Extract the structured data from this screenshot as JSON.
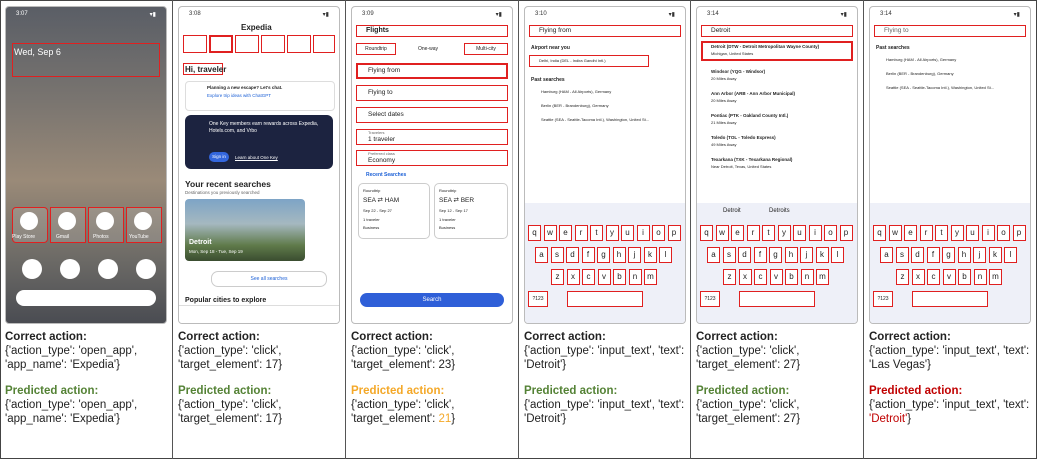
{
  "panels": [
    {
      "time": "3:07",
      "correct": "{'action_type': 'open_app', 'app_name': 'Expedia'}",
      "predicted": "{'action_type': 'open_app', 'app_name': 'Expedia'}",
      "status": "correct"
    },
    {
      "time": "3:08",
      "correct": "{'action_type': 'click', 'target_element': 17}",
      "predicted": "{'action_type': 'click', 'target_element': 17}",
      "status": "correct"
    },
    {
      "time": "3:09",
      "correct": "{'action_type': 'click', 'target_element': 23}",
      "predicted_prefix": "{'action_type': 'click', 'target_element': ",
      "predicted_value": "21",
      "predicted_suffix": "}",
      "status": "partial"
    },
    {
      "time": "3:10",
      "correct": "{'action_type': 'input_text', 'text': 'Detroit'}",
      "predicted": "{'action_type': 'input_text', 'text': 'Detroit'}",
      "status": "correct"
    },
    {
      "time": "3:14",
      "correct": "{'action_type': 'click', 'target_element': 27}",
      "predicted": "{'action_type': 'click', 'target_element': 27}",
      "status": "correct"
    },
    {
      "time": "3:14",
      "correct": "{'action_type': 'input_text', 'text': 'Las Vegas'}",
      "predicted_prefix": "{'action_type': 'input_text', 'text': ",
      "predicted_value": "'Detroit'",
      "predicted_suffix": "}",
      "status": "wrong"
    }
  ],
  "labels": {
    "correct_action": "Correct action:",
    "predicted_action": "Predicted action:"
  },
  "screen1": {
    "date": "Wed, Sep 6",
    "apps": [
      "Play Store",
      "Gmail",
      "Photos",
      "YouTube"
    ]
  },
  "screen2": {
    "brand": "Expedia",
    "greeting": "Hi, traveler",
    "promo_title": "Planning a new escape? Let's chat.",
    "promo_link": "Explore trip ideas with ChatGPT",
    "onekey": "One Key members earn rewards across Expedia, Hotels.com, and Vrbo",
    "signin": "Sign in",
    "learn": "Learn about One Key",
    "recent": "Your recent searches",
    "recent_sub": "Destinations you previously searched",
    "card_city": "Detroit",
    "card_dates": "Mon, Sep 18 - Tue, Sep 19",
    "see_all": "See all searches",
    "popular": "Popular cities to explore"
  },
  "screen3": {
    "header": "Flights",
    "tabs": [
      "Roundtrip",
      "One-way",
      "Multi-city"
    ],
    "fields": [
      "Flying from",
      "Flying to",
      "Select dates"
    ],
    "travelers_label": "Travelers",
    "travelers": "1 traveler",
    "class_label": "Preferred class",
    "class": "Economy",
    "recent": "Recent Searches",
    "cards": [
      {
        "type": "Roundtrip",
        "route": "SEA ⇄ HAM",
        "dates": "Sep 22 - Sep 27",
        "trav": "1 traveler",
        "cls": "Business"
      },
      {
        "type": "Roundtrip",
        "route": "SEA ⇄ BER",
        "dates": "Sep 12 - Sep 17",
        "trav": "1 traveler",
        "cls": "Business"
      }
    ],
    "search": "Search"
  },
  "screen4": {
    "input": "Flying from",
    "airport_header": "Airport near you",
    "airport": "Delhi, India (DEL - Indira Gandhi Intl.)",
    "past": "Past searches",
    "items": [
      "Hamburg (HAM - All Airports), Germany",
      "Berlin (BER - Brandenburg), Germany",
      "Seattle (SEA - Seattle-Tacoma Intl.), Washington, United St..."
    ]
  },
  "screen5": {
    "input": "Detroit",
    "results": [
      {
        "t": "Detroit (DTW - Detroit Metropolitan Wayne County)",
        "s": "Michigan, United States"
      },
      {
        "t": "Windsor (YQG - Windsor)",
        "s": "20 Miles Away"
      },
      {
        "t": "Ann Arbor (ARB - Ann Arbor Municipal)",
        "s": "20 Miles Away"
      },
      {
        "t": "Pontiac (PTK - Oakland County Intl.)",
        "s": "21 Miles Away"
      },
      {
        "t": "Toledo (TOL - Toledo Express)",
        "s": "49 Miles Away"
      },
      {
        "t": "Texarkana (TXK - Texarkana Regional)",
        "s": "Near Detroit, Texas, United States"
      }
    ],
    "suggestions": [
      "Detroit",
      "Detroits"
    ]
  },
  "screen6": {
    "input": "Flying to",
    "past": "Past searches"
  },
  "keyboard": {
    "row1": [
      "q",
      "w",
      "e",
      "r",
      "t",
      "y",
      "u",
      "i",
      "o",
      "p"
    ],
    "row2": [
      "a",
      "s",
      "d",
      "f",
      "g",
      "h",
      "j",
      "k",
      "l"
    ],
    "row3": [
      "z",
      "x",
      "c",
      "v",
      "b",
      "n",
      "m"
    ],
    "mode": "?123"
  }
}
